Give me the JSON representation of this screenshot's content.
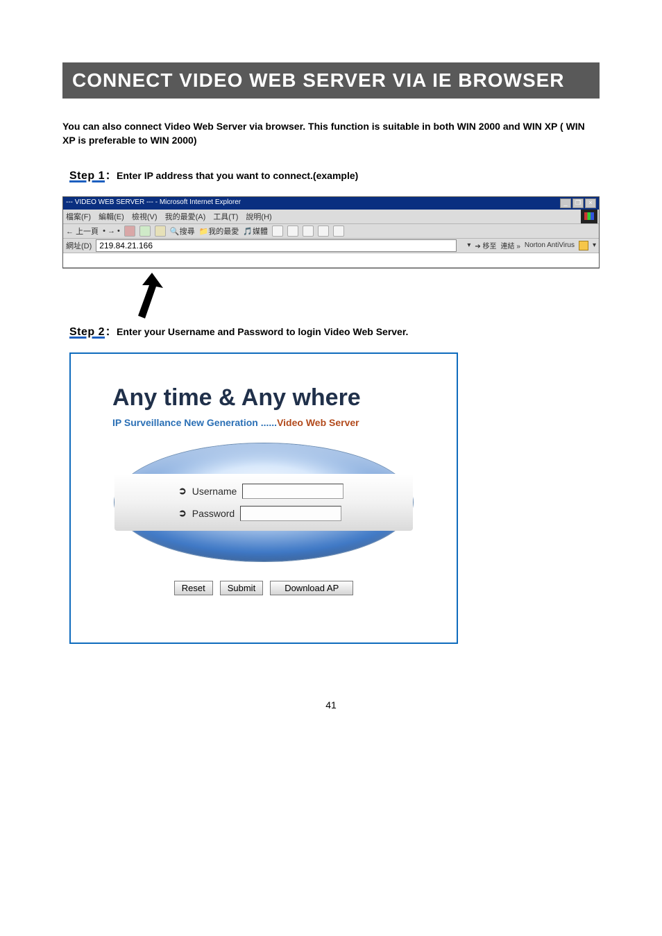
{
  "page": {
    "title": "CONNECT VIDEO WEB SERVER VIA IE BROWSER",
    "intro": "You can also connect Video Web Server via browser. This function is suitable in both WIN 2000 and WIN XP ( WIN XP is preferable to WIN 2000)",
    "pageNumber": "41"
  },
  "step1": {
    "label": "Step 1",
    "colon": "：",
    "text": "Enter IP address that you want to connect.(example)"
  },
  "ie": {
    "windowTitle": "--- VIDEO WEB SERVER --- - Microsoft Internet Explorer",
    "winBtn": {
      "min": "_",
      "max": "❐",
      "close": "×"
    },
    "menu": {
      "file": "檔案(F)",
      "edit": "編輯(E)",
      "view": "檢視(V)",
      "fav": "我的最愛(A)",
      "tools": "工具(T)",
      "help": "說明(H)"
    },
    "toolbar": {
      "back": "上一頁",
      "search": "搜尋",
      "favorites": "我的最愛",
      "media": "媒體"
    },
    "addressLabel": "網址(D)",
    "addressValue": "219.84.21.166",
    "goLabel": "移至",
    "linksLabel": "連結",
    "nortonLabel": "Norton AntiVirus"
  },
  "step2": {
    "label": "Step 2",
    "colon": "：",
    "text": "Enter your Username and Password to login Video Web Server."
  },
  "login": {
    "title": "Any time & Any where",
    "subA": "IP Surveillance New Generation ......",
    "subB": "Video Web Server",
    "bullet": "➲",
    "usernameLabel": "Username",
    "passwordLabel": "Password",
    "reset": "Reset",
    "submit": "Submit",
    "download": "Download AP"
  }
}
